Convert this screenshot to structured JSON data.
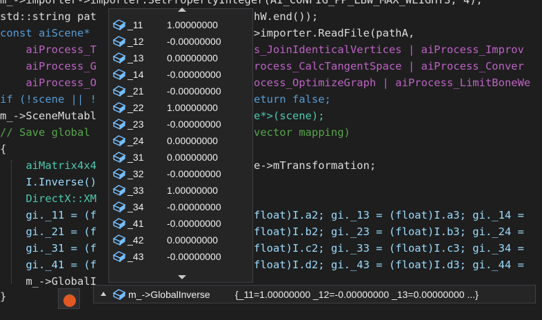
{
  "code": {
    "l1": "m_->importer->importer.SetPropertyInteger(AI_CONFIG_PP_LBW_MAX_WEIGHTS, 4);",
    "l2": "std::string pat",
    "l2r": "hW.end());",
    "l3": "const aiScene*",
    "l3r": ">importer.ReadFile(pathA,",
    "l4": "    aiProcess_T",
    "l4r": "s_JoinIdenticalVertices | aiProcess_Improv",
    "l5": "    aiProcess_G",
    "l5r": "rocess_CalcTangentSpace | aiProcess_Conver",
    "l6": "    aiProcess_O",
    "l6r": "ocess_OptimizeGraph | aiProcess_LimitBoneWe",
    "l7": "if (!scene || !",
    "l7r": "eturn false;",
    "l8": "m_->SceneMutabl",
    "l8r": "e*>(scene);",
    "l9": "// Save global",
    "l9r": "vector mapping)",
    "l10": "{",
    "l11": "    aiMatrix4x4",
    "l11r": "e->mTransformation;",
    "l12": "    I.Inverse()",
    "l13": "    DirectX::XM",
    "l14": "    gi._11 = (f",
    "l14r": "float)I.a2; gi._13 = (float)I.a3; gi._14 =",
    "l15": "    gi._21 = (f",
    "l15r": "float)I.b2; gi._23 = (float)I.b3; gi._24 =",
    "l16": "    gi._31 = (f",
    "l16r": "float)I.c2; gi._33 = (float)I.c3; gi._34 =",
    "l17": "    gi._41 = (f",
    "l17r": "float)I.d2; gi._43 = (float)I.d3; gi._44 =",
    "l18": "    m_->GlobalI",
    "l19": "}"
  },
  "popup": {
    "fields": [
      {
        "name": "_11",
        "value": "1.00000000"
      },
      {
        "name": "_12",
        "value": "-0.00000000"
      },
      {
        "name": "_13",
        "value": "0.00000000"
      },
      {
        "name": "_14",
        "value": "-0.00000000"
      },
      {
        "name": "_21",
        "value": "-0.00000000"
      },
      {
        "name": "_22",
        "value": "1.00000000"
      },
      {
        "name": "_23",
        "value": "-0.00000000"
      },
      {
        "name": "_24",
        "value": "0.00000000"
      },
      {
        "name": "_31",
        "value": "0.00000000"
      },
      {
        "name": "_32",
        "value": "-0.00000000"
      },
      {
        "name": "_33",
        "value": "1.00000000"
      },
      {
        "name": "_34",
        "value": "-0.00000000"
      },
      {
        "name": "_41",
        "value": "-0.00000000"
      },
      {
        "name": "_42",
        "value": "0.00000000"
      },
      {
        "name": "_43",
        "value": "-0.00000000"
      }
    ]
  },
  "datatip": {
    "expression": "m_->GlobalInverse",
    "value": "{_11=1.00000000 _12=-0.00000000 _13=0.00000000 ...}"
  },
  "icons": {
    "field": "cube-field-icon",
    "expand": "expand-arrow-icon",
    "tomato": "tomato-icon"
  },
  "colors": {
    "editor_bg": "#1e1e1e",
    "popup_bg": "#252526",
    "keyword": "#569cd6",
    "comment": "#57a64a",
    "function": "#dcdcaa",
    "type": "#4ec9b0",
    "icon": "#75beff"
  }
}
